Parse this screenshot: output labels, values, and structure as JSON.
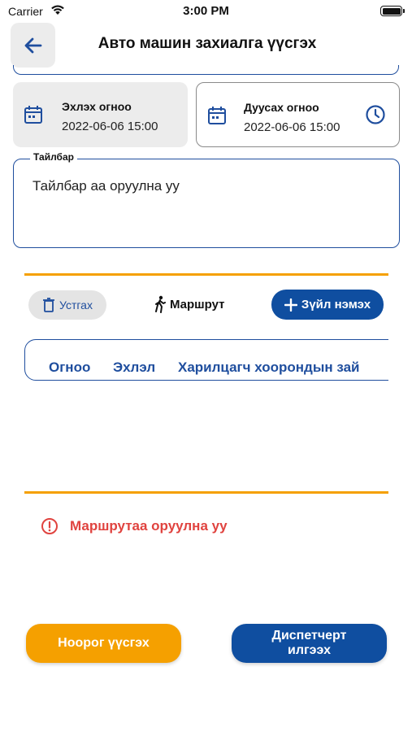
{
  "status_bar": {
    "carrier": "Carrier",
    "time": "3:00 PM",
    "battery_level": 1.0
  },
  "header": {
    "title": "Авто машин захиалга үүсгэх",
    "back_icon": "arrow-left-icon"
  },
  "dates": {
    "start": {
      "label": "Эхлэх огноо",
      "value": "2022-06-06 15:00"
    },
    "end": {
      "label": "Дуусах огноо",
      "value": "2022-06-06 15:00"
    }
  },
  "description": {
    "label": "Тайлбар",
    "placeholder": "Тайлбар аа оруулна уу"
  },
  "route_toolbar": {
    "delete_label": "Устгах",
    "route_label": "Маршрут",
    "add_label": "Зүйл нэмэх"
  },
  "route_table": {
    "columns": [
      "Огноо",
      "Эхлэл",
      "Харилцагч хоорондын зай"
    ]
  },
  "error": {
    "message": "Маршрутаа оруулна уу"
  },
  "actions": {
    "draft_label": "Ноорог үүсгэх",
    "send_label_line1": "Диспетчерт",
    "send_label_line2": "илгээх"
  },
  "colors": {
    "primary": "#0f4ea0",
    "accent": "#f5a000",
    "error": "#e0433f"
  }
}
